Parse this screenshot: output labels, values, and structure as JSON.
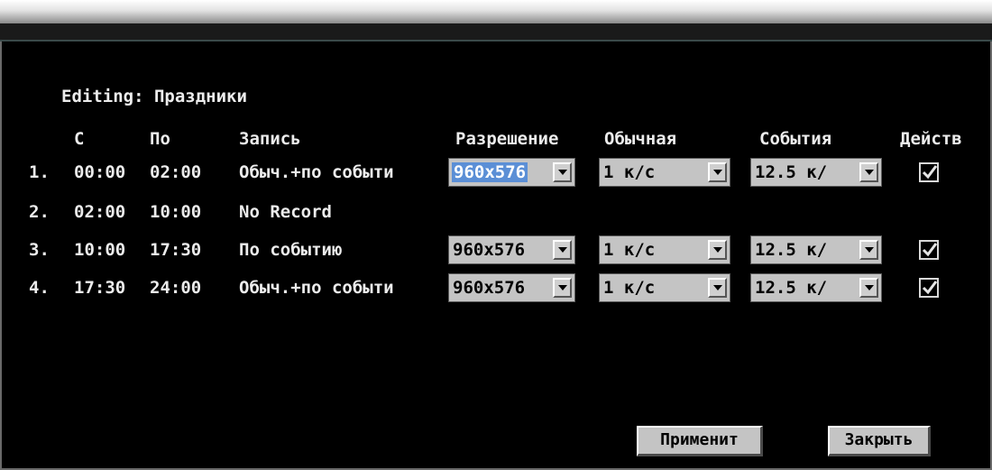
{
  "title": "Editing: Праздники",
  "headers": {
    "start": "С",
    "end": "По",
    "record": "Запись",
    "resolution": "Разрешение",
    "normal": "Обычная",
    "events": "События",
    "action": "Действ"
  },
  "rows": [
    {
      "num": "1.",
      "start": "00:00",
      "end": "02:00",
      "record": "Обыч.+по событи",
      "resolution": "960x576",
      "normal": "1 к/с",
      "events": "12.5 к/",
      "action_checked": true
    },
    {
      "num": "2.",
      "start": "02:00",
      "end": "10:00",
      "record": "No Record"
    },
    {
      "num": "3.",
      "start": "10:00",
      "end": "17:30",
      "record": "По событию",
      "resolution": "960x576",
      "normal": "1 к/с",
      "events": "12.5 к/",
      "action_checked": true
    },
    {
      "num": "4.",
      "start": "17:30",
      "end": "24:00",
      "record": "Обыч.+по событи",
      "resolution": "960x576",
      "normal": "1 к/с",
      "events": "12.5 к/",
      "action_checked": true
    }
  ],
  "buttons": {
    "apply": "Применит",
    "close": "Закрыть"
  }
}
